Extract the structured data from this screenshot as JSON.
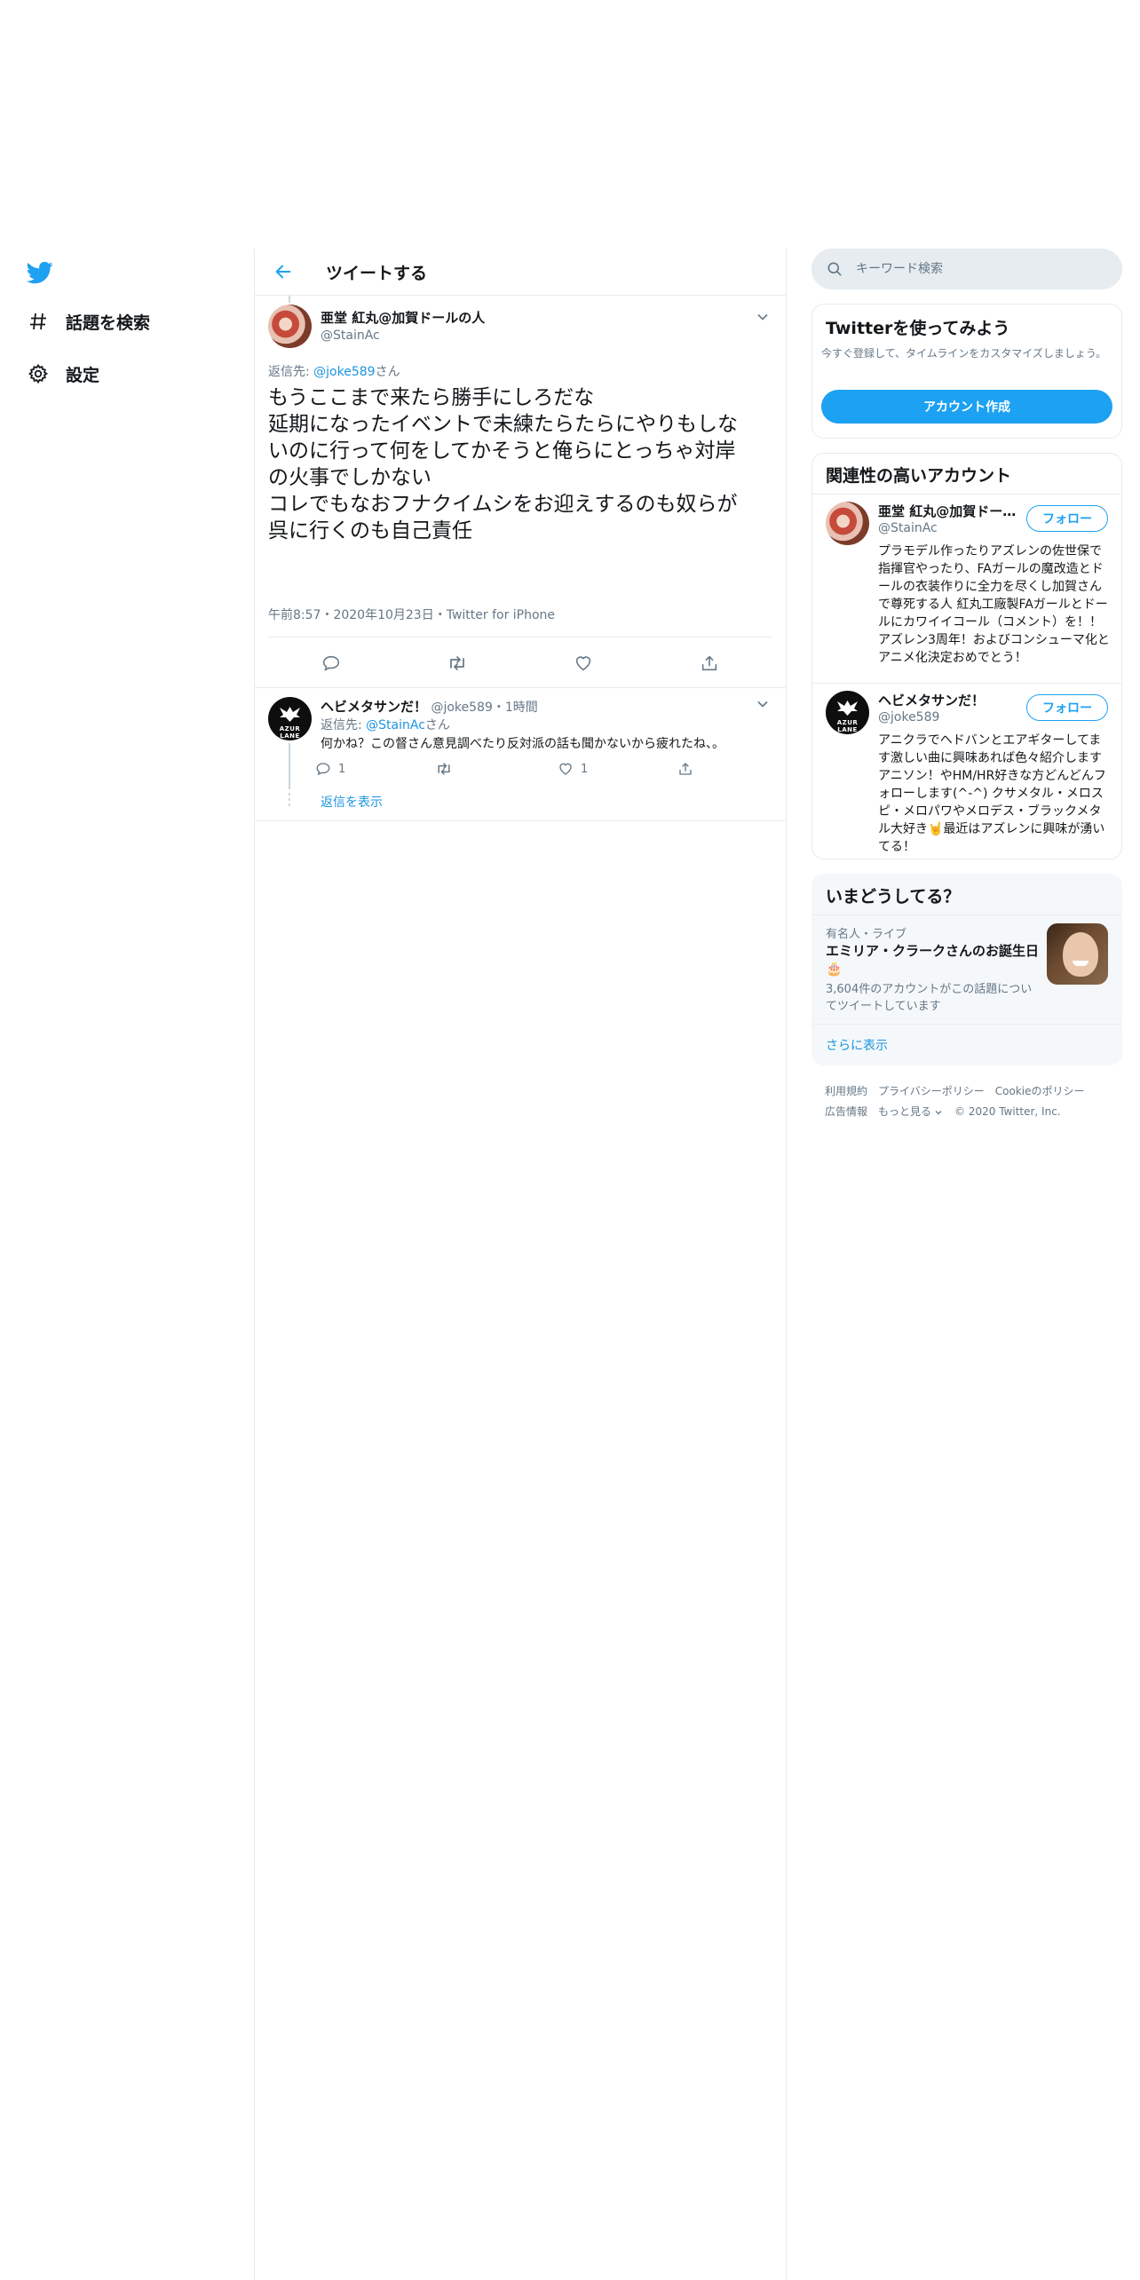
{
  "nav": {
    "logo": "twitter-bird",
    "items": [
      {
        "label": "話題を検索",
        "icon": "hashtag-icon"
      },
      {
        "label": "設定",
        "icon": "gear-icon"
      }
    ]
  },
  "header": {
    "title": "ツイートする"
  },
  "main_tweet": {
    "name": "亜堂 紅丸@加賀ドールの人",
    "handle": "@StainAc",
    "reply_prefix": "返信先: ",
    "reply_handle": "@joke589",
    "reply_suffix": "さん",
    "text_lines": [
      "もうここまで来たら勝手にしろだな",
      "延期になったイベントで未練たらたらにやりもしな",
      "いのに行って何をしてかそうと俺らにとっちゃ対岸",
      "の火事でしかない",
      "コレでもなおフナクイムシをお迎えするのも奴らが",
      "呉に行くのも自己責任"
    ],
    "time": "午前8:57",
    "date": "2020年10月23日",
    "source": "Twitter for iPhone",
    "dot": "・"
  },
  "reply_tweet": {
    "name": "ヘビメタサンだ！",
    "handle": "@joke589",
    "dot": "・",
    "time": "1時間",
    "reply_prefix": "返信先: ",
    "reply_handle": "@StainAc",
    "reply_suffix": "さん",
    "text": "何かね？この督さん意見調べたり反対派の話も聞かないから疲れたね、。",
    "reply_count": "1",
    "like_count": "1",
    "show_replies": "返信を表示",
    "avatar_text": "AZUR LANE"
  },
  "search": {
    "placeholder": "キーワード検索"
  },
  "signup": {
    "title": "Twitterを使ってみよう",
    "subtitle": "今すぐ登録して、タイムラインをカスタマイズしましょう。",
    "button": "アカウント作成"
  },
  "related": {
    "title": "関連性の高いアカウント",
    "accounts": [
      {
        "name": "亜堂 紅丸@加賀ドールの人",
        "handle": "@StainAc",
        "follow": "フォロー",
        "bio": "プラモデル作ったりアズレンの佐世保で指揮官やったり、FAガールの魔改造とドールの衣装作りに全力を尽くし加賀さんで尊死する人 紅丸工廠製FAガールとドールにカワイイコール（コメント）を！！ アズレン3周年！およびコンシューマ化とアニメ化決定おめでとう！"
      },
      {
        "name": "ヘビメタサンだ！",
        "handle": "@joke589",
        "follow": "フォロー",
        "bio": "アニクラでヘドバンとエアギターしてます激しい曲に興味あれば色々紹介します アニソン！やHM/HR好きな方どんどんフォローします(^-^) クサメタル・メロスピ・メロパワやメロデス・ブラックメタル大好き🤘最近はアズレンに興味が湧いてる！"
      }
    ]
  },
  "trends": {
    "title": "いまどうしてる？",
    "category": "有名人・ライブ",
    "topic": "エミリア・クラークさんのお誕生日🎂",
    "description": "3,604件のアカウントがこの話題についてツイートしています",
    "show_more": "さらに表示"
  },
  "footer": {
    "links": [
      "利用規約",
      "プライバシーポリシー",
      "Cookieのポリシー",
      "広告情報",
      "もっと見る"
    ],
    "copyright": "© 2020 Twitter, Inc."
  },
  "colors": {
    "accent": "#1da1f2",
    "link": "#1b95e0",
    "secondary_text": "#657786",
    "border": "#e6ecf0"
  }
}
